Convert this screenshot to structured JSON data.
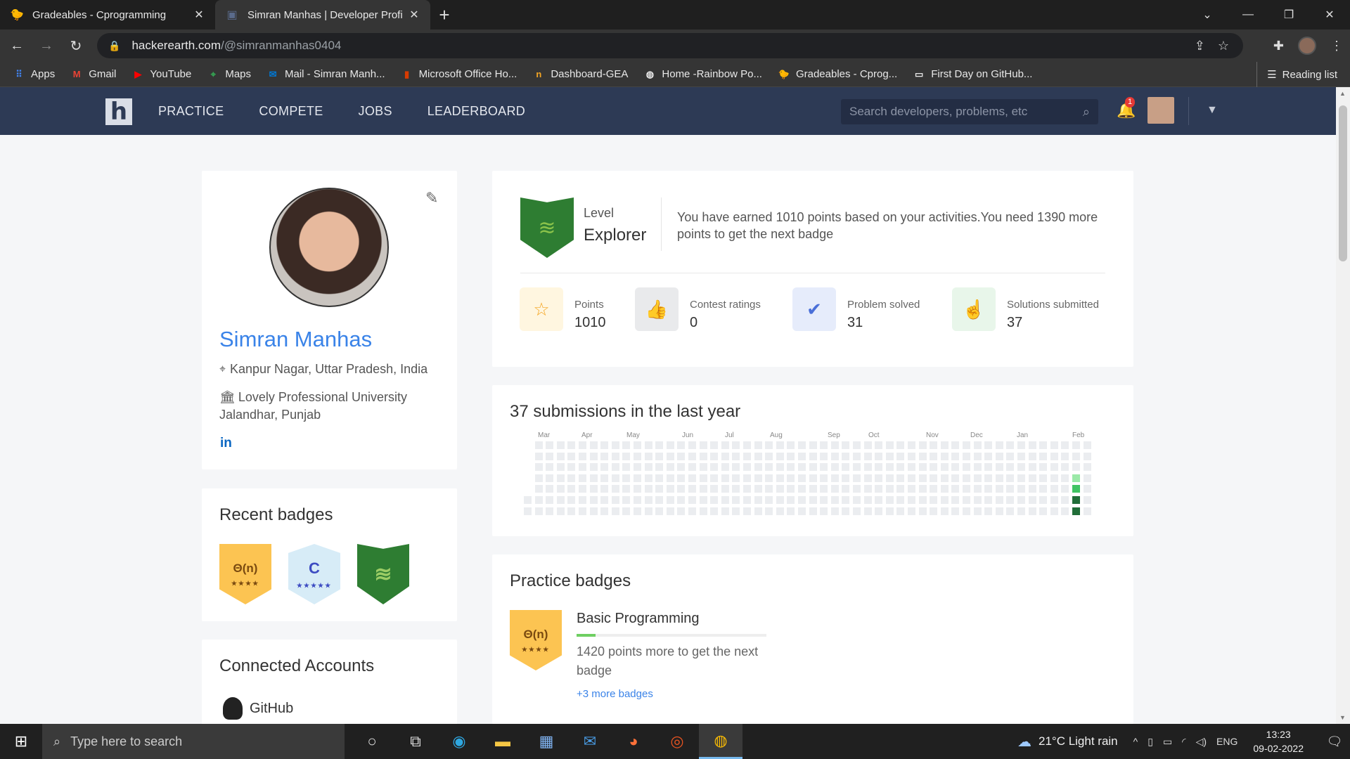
{
  "browser": {
    "tabs": [
      {
        "title": "Gradeables - Cprogramming",
        "icon": "duck-icon",
        "active": false
      },
      {
        "title": "Simran Manhas | Developer Profi",
        "icon": "hackerearth-icon",
        "active": true
      }
    ],
    "url_host": "hackerearth.com",
    "url_path": "/@simranmanhas0404",
    "bookmarks": [
      {
        "label": "Apps",
        "icon": "apps-grid-icon"
      },
      {
        "label": "Gmail",
        "icon": "gmail-icon"
      },
      {
        "label": "YouTube",
        "icon": "youtube-icon"
      },
      {
        "label": "Maps",
        "icon": "maps-icon"
      },
      {
        "label": "Mail - Simran Manh...",
        "icon": "outlook-icon"
      },
      {
        "label": "Microsoft Office Ho...",
        "icon": "office-icon"
      },
      {
        "label": "Dashboard-GEA",
        "icon": "dashboard-icon"
      },
      {
        "label": "Home -Rainbow Po...",
        "icon": "globe-icon"
      },
      {
        "label": "Gradeables - Cprog...",
        "icon": "duck-icon"
      },
      {
        "label": "First Day on GitHub...",
        "icon": "page-icon"
      }
    ],
    "reading_list": "Reading list"
  },
  "site": {
    "nav": [
      "PRACTICE",
      "COMPETE",
      "JOBS",
      "LEADERBOARD"
    ],
    "search_placeholder": "Search developers, problems, etc",
    "notifications": "1"
  },
  "profile": {
    "name": "Simran Manhas",
    "location": "Kanpur Nagar, Uttar Pradesh, India",
    "university_line1": "Lovely Professional University",
    "university_line2": "Jalandhar, Punjab",
    "linkedin": "in"
  },
  "recent_badges": {
    "title": "Recent badges",
    "items": [
      {
        "text": "Θ(n)",
        "stars": "★★★★",
        "style": "gold"
      },
      {
        "text": "C",
        "stars": "★★★★★",
        "style": "blue"
      },
      {
        "text": "≋",
        "stars": "",
        "style": "green"
      }
    ]
  },
  "connected": {
    "title": "Connected Accounts",
    "github": "GitHub"
  },
  "level": {
    "label": "Level",
    "name": "Explorer",
    "message": "You have earned 1010 points based on your activities.You need 1390 more points to get the next badge",
    "stats": [
      {
        "label": "Points",
        "value": "1010",
        "icon": "star-icon",
        "bg": "#fff6e0",
        "color": "#f5a623"
      },
      {
        "label": "Contest ratings",
        "value": "0",
        "icon": "thumbs-up-icon",
        "bg": "#e9eaec",
        "color": "#888888"
      },
      {
        "label": "Problem solved",
        "value": "31",
        "icon": "check-circle-icon",
        "bg": "#e6ecfb",
        "color": "#4a6fd8"
      },
      {
        "label": "Solutions submitted",
        "value": "37",
        "icon": "pointer-hand-icon",
        "bg": "#e8f6ea",
        "color": "#43a047"
      }
    ]
  },
  "submissions": {
    "title": "37 submissions in the last year",
    "months": [
      "Mar",
      "Apr",
      "May",
      "Jun",
      "Jul",
      "Aug",
      "Sep",
      "Oct",
      "Nov",
      "Dec",
      "Jan",
      "Feb"
    ],
    "active_cells": [
      {
        "week": 50,
        "day": 3,
        "level": 1
      },
      {
        "week": 50,
        "day": 4,
        "level": 2
      },
      {
        "week": 50,
        "day": 5,
        "level": 3
      },
      {
        "week": 50,
        "day": 6,
        "level": 3
      }
    ],
    "colors": [
      "#ebedf0",
      "#9be9a8",
      "#40c463",
      "#216e39"
    ]
  },
  "practice": {
    "title": "Practice badges",
    "badge_text": "Θ(n)",
    "badge_stars": "★★★★",
    "badge_title": "Basic Programming",
    "progress": 0.1,
    "message": "1420 points more to get the next badge",
    "more": "+3 more badges"
  },
  "taskbar": {
    "search_placeholder": "Type here to search",
    "weather": "21°C  Light rain",
    "lang": "ENG",
    "time": "13:23",
    "date": "09-02-2022"
  }
}
